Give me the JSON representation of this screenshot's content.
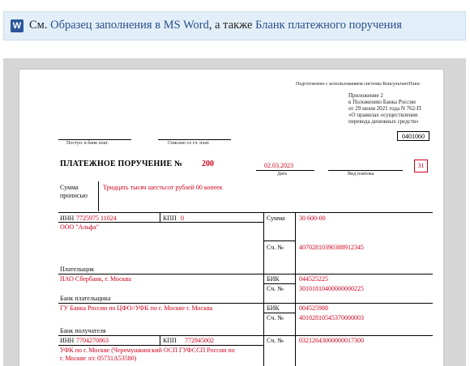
{
  "info": {
    "prefix": "См.",
    "link1": "Образец заполнения в MS Word",
    "middle": ", а также",
    "link2": "Бланк платежного поручения",
    "icon": "word-icon"
  },
  "doc": {
    "prepared": "Подготовлено с использованием системы КонсультантПлюс",
    "appendix": [
      "Приложение 2",
      "к Положению Банка России",
      "от 29 июня 2021 года N 762-П",
      "«О правилах осуществления",
      "перевода денежных средств»"
    ],
    "form_code": "0401060",
    "received_label": "Поступ. в банк плат.",
    "debited_label": "Списано со сч. плат.",
    "title": "ПЛАТЕЖНОЕ ПОРУЧЕНИЕ №",
    "number": "200",
    "date": "02.03.2023",
    "date_label": "Дата",
    "payment_type_label": "Вид платежа",
    "status_code": "31",
    "amount_words_label_1": "Сумма",
    "amount_words_label_2": "прописью",
    "amount_words": "Тридцать тысяч шестьсот рублей 00 копеек",
    "inn_label": "ИНН",
    "payer_inn": "7725975 11024",
    "kpp_label": "КПП",
    "payer_kpp": "0",
    "amount_label": "Сумма",
    "amount": "30 600-00",
    "payer_name": "ООО \"Альфа\"",
    "account_label": "Сч. №",
    "payer_account": "40702810390388912345",
    "payer_label": "Плательщик",
    "payer_bank": "ПАО Сбербанк, г. Москва",
    "bik_label": "БИК",
    "payer_bik": "044525225",
    "payer_corr": "30101810400000000225",
    "payer_bank_label": "Банк плательщика",
    "recipient_bank": "ГУ Банка России по ЦФО//УФК по г. Москве г. Москва",
    "recipient_bik": "004525988",
    "recipient_corr": "40102810545370000003",
    "recipient_bank_label": "Банк получателя",
    "recipient_inn": "7704270863",
    "recipient_kpp": "772845002",
    "recipient_account": "03212643000000017300",
    "recipient_name_1": "УФК по г. Москве (Черемушкинский ОСП ГУФССП России по",
    "recipient_name_2": "г. Москве л/с 05731А53580)"
  }
}
